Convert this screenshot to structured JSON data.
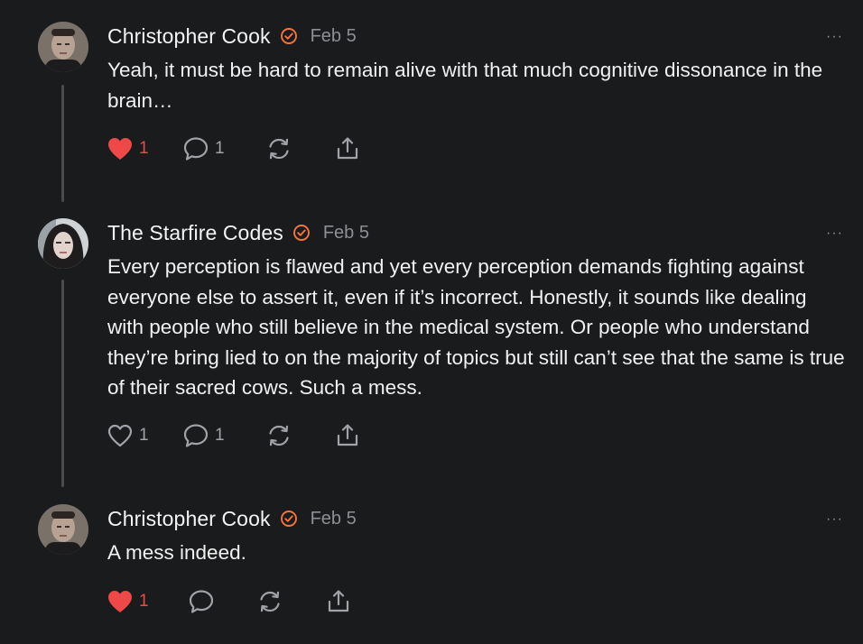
{
  "comments": [
    {
      "author": "Christopher Cook",
      "verified": true,
      "date": "Feb 5",
      "more": "···",
      "text": "Yeah, it must be hard to remain alive with that much cognitive dissonance in the brain…",
      "likes": "1",
      "liked": true,
      "replies": "1",
      "icons": [
        "heart-icon",
        "comment-icon",
        "restack-icon",
        "share-icon"
      ]
    },
    {
      "author": "The Starfire Codes",
      "verified": true,
      "date": "Feb 5",
      "more": "···",
      "text": "Every perception is flawed and yet every perception demands fighting against everyone else to assert it, even if it’s incorrect. Honestly, it sounds like dealing with people who still believe in the medical system. Or people who understand they’re bring lied to on the majority of topics but still can’t see that the same is true of their sacred cows. Such a mess.",
      "likes": "1",
      "liked": false,
      "replies": "1",
      "icons": [
        "heart-icon",
        "comment-icon",
        "restack-icon",
        "share-icon"
      ]
    },
    {
      "author": "Christopher Cook",
      "verified": true,
      "date": "Feb 5",
      "more": "···",
      "text": "A mess indeed.",
      "likes": "1",
      "liked": true,
      "replies": "",
      "icons": [
        "heart-icon",
        "comment-icon",
        "restack-icon",
        "share-icon"
      ]
    }
  ],
  "colors": {
    "background": "#1a1b1d",
    "text": "#f1f1f1",
    "muted": "#8e8f94",
    "accent": "#f4743b",
    "like": "#ef4848",
    "thread_line": "#4a4b4f"
  }
}
